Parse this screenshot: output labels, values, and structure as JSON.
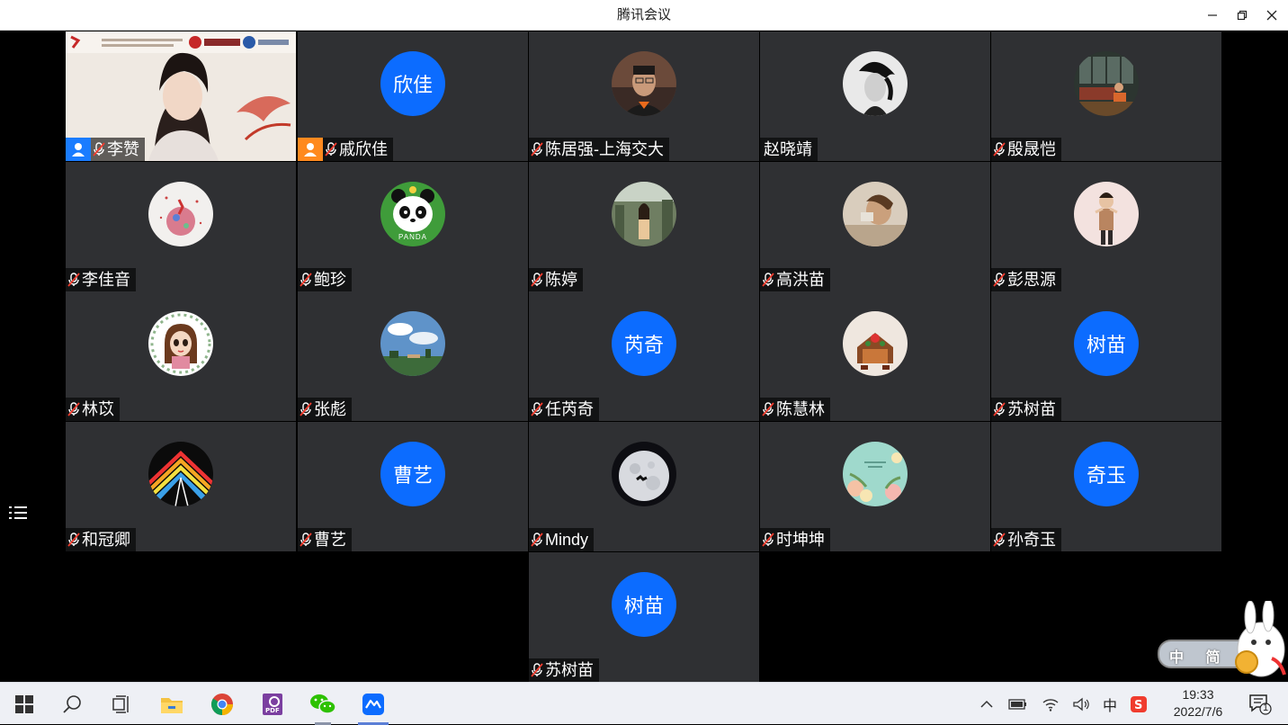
{
  "window": {
    "title": "腾讯会议"
  },
  "participants": [
    {
      "name": "李赞",
      "camera": true,
      "host": true
    },
    {
      "name": "戚欣佳",
      "avatar_text": "欣佳",
      "host": true,
      "host_color": "#ff8a1f"
    },
    {
      "name": "陈居强-上海交大",
      "avatar": "photo-man"
    },
    {
      "name": "赵晓靖",
      "avatar": "photo-bw",
      "no_mic": true
    },
    {
      "name": "殷晟恺",
      "avatar": "photo-piano"
    },
    {
      "name": "李佳音",
      "avatar": "art-planet"
    },
    {
      "name": "鲍珍",
      "avatar": "panda",
      "avatar_label": "PANDA"
    },
    {
      "name": "陈婷",
      "avatar": "photo-girl-forest"
    },
    {
      "name": "高洪苗",
      "avatar": "photo-warm"
    },
    {
      "name": "彭思源",
      "avatar": "photo-pink"
    },
    {
      "name": "林苡",
      "avatar": "cartoon-girl"
    },
    {
      "name": "张彪",
      "avatar": "photo-sky"
    },
    {
      "name": "任芮奇",
      "avatar_text": "芮奇"
    },
    {
      "name": "陈慧林",
      "avatar": "photo-food"
    },
    {
      "name": "苏树苗",
      "avatar_text": "树苗"
    },
    {
      "name": "和冠卿",
      "avatar": "art-rainbow"
    },
    {
      "name": "曹艺",
      "avatar_text": "曹艺"
    },
    {
      "name": "Mindy",
      "avatar": "moon"
    },
    {
      "name": "时坤坤",
      "avatar": "art-floral"
    },
    {
      "name": "孙奇玉",
      "avatar_text": "奇玉"
    },
    {
      "name": "苏树苗",
      "avatar_text": "树苗"
    }
  ],
  "taskbar": {
    "clock_time": "19:33",
    "clock_date": "2022/7/6",
    "ime": "中",
    "notifications": "1",
    "apps": [
      "windows-start",
      "search",
      "task-view",
      "file-explorer",
      "chrome",
      "pdf-reader",
      "wechat",
      "tencent-meeting"
    ]
  },
  "ime_sticker": "中 简",
  "colors": {
    "avatar_blue": "#0c6cff",
    "tile_bg": "#2f3033",
    "host_badge": "#1a7cff"
  }
}
